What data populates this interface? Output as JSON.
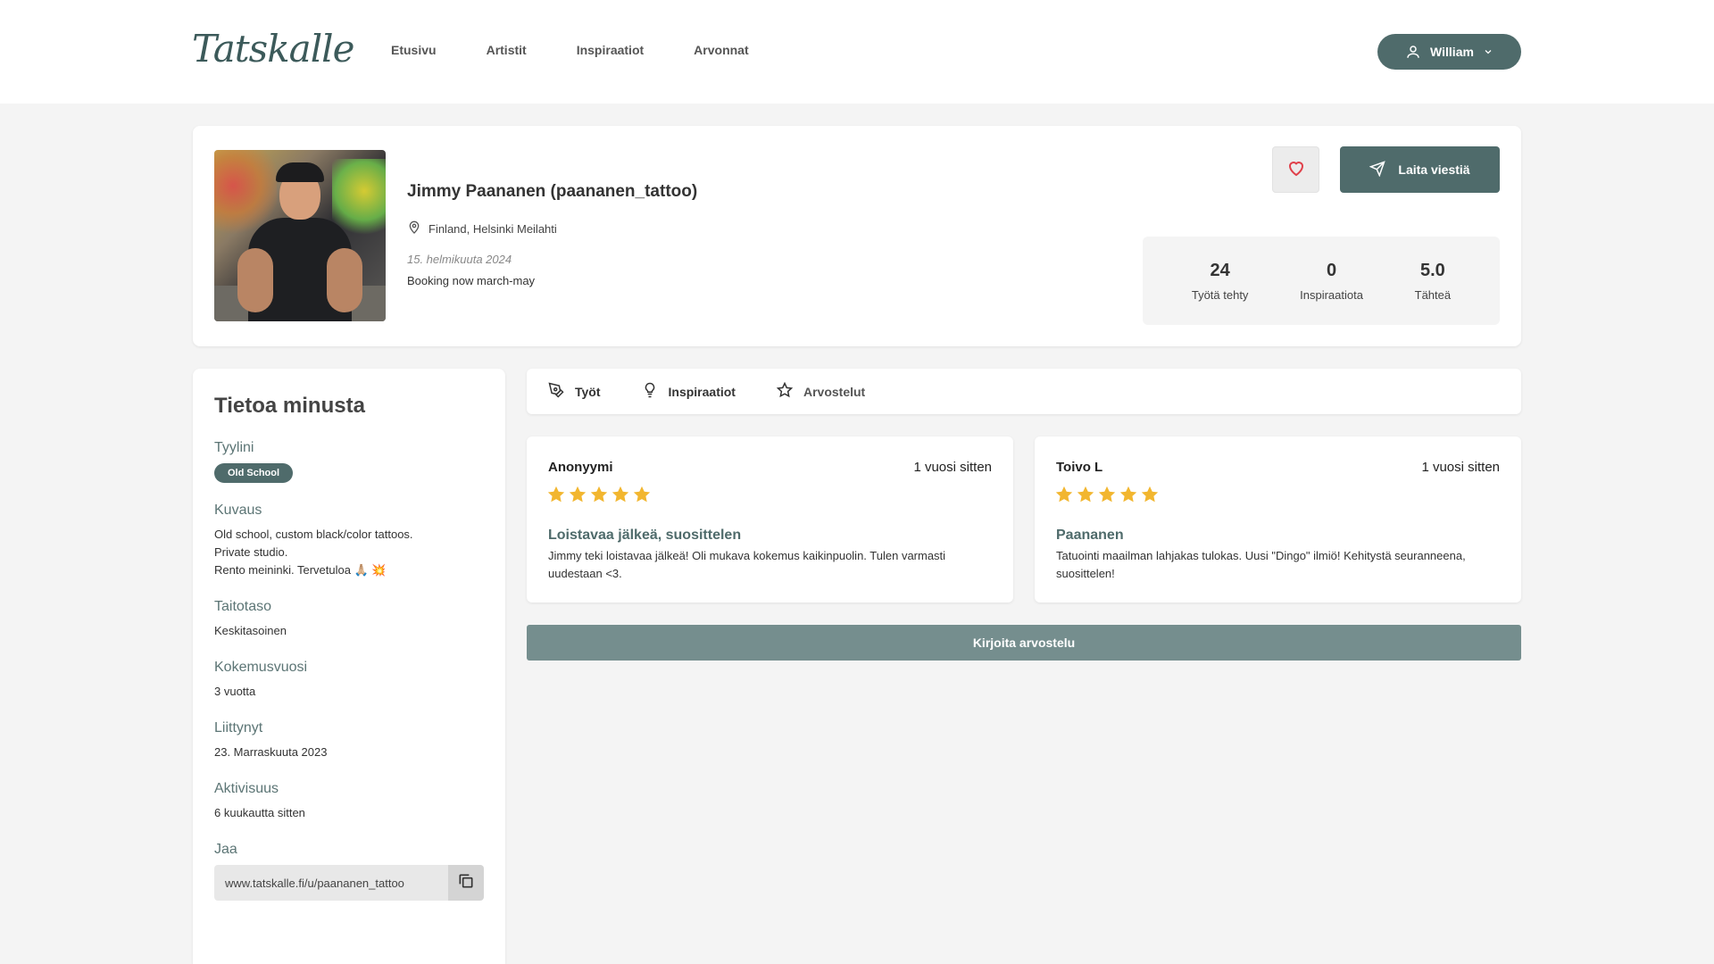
{
  "brand": {
    "logo_text": "Tatskalle",
    "accent": "#4f6b6b",
    "star_color": "#f2b62f",
    "heart_color": "#e0404a"
  },
  "nav": {
    "items": [
      {
        "label": "Etusivu"
      },
      {
        "label": "Artistit"
      },
      {
        "label": "Inspiraatiot"
      },
      {
        "label": "Arvonnat"
      }
    ]
  },
  "user": {
    "name": "William",
    "icon": "user-icon"
  },
  "profile": {
    "name": "Jimmy Paananen (paananen_tattoo)",
    "location": "Finland, Helsinki Meilahti",
    "date": "15. helmikuuta 2024",
    "status": "Booking now march-may",
    "message_label": "Laita viestiä",
    "stats": [
      {
        "value": "24",
        "label": "Työtä tehty"
      },
      {
        "value": "0",
        "label": "Inspiraatiota"
      },
      {
        "value": "5.0",
        "label": "Tähteä"
      }
    ]
  },
  "about": {
    "title": "Tietoa minusta",
    "style_label": "Tyylini",
    "style_tag": "Old School",
    "description_label": "Kuvaus",
    "description_lines": [
      "Old school, custom black/color tattoos.",
      "Private studio.",
      "Rento meininki. Tervetuloa 🙏🏼 💥"
    ],
    "skill_label": "Taitotaso",
    "skill_value": "Keskitasoinen",
    "experience_label": "Kokemusvuosi",
    "experience_value": "3 vuotta",
    "joined_label": "Liittynyt",
    "joined_value": "23. Marraskuuta 2023",
    "activity_label": "Aktivisuus",
    "activity_value": "6 kuukautta sitten",
    "share_label": "Jaa",
    "share_url": "www.tatskalle.fi/u/paananen_tattoo"
  },
  "tabs": [
    {
      "label": "Työt",
      "icon": "pen-tool-icon"
    },
    {
      "label": "Inspiraatiot",
      "icon": "lightbulb-icon"
    },
    {
      "label": "Arvostelut",
      "icon": "star-outline-icon"
    }
  ],
  "reviews": [
    {
      "author": "Anonyymi",
      "when": "1 vuosi sitten",
      "rating": 5,
      "title": "Loistavaa jälkeä, suosittelen",
      "text": "Jimmy teki loistavaa jälkeä! Oli mukava kokemus kaikinpuolin. Tulen varmasti uudestaan <3."
    },
    {
      "author": "Toivo L",
      "when": "1 vuosi sitten",
      "rating": 5,
      "title": "Paananen",
      "text": "Tatuointi maailman lahjakas tulokas. Uusi \"Dingo\" ilmiö! Kehitystä seuranneena, suosittelen!"
    }
  ],
  "write_review_label": "Kirjoita arvostelu"
}
